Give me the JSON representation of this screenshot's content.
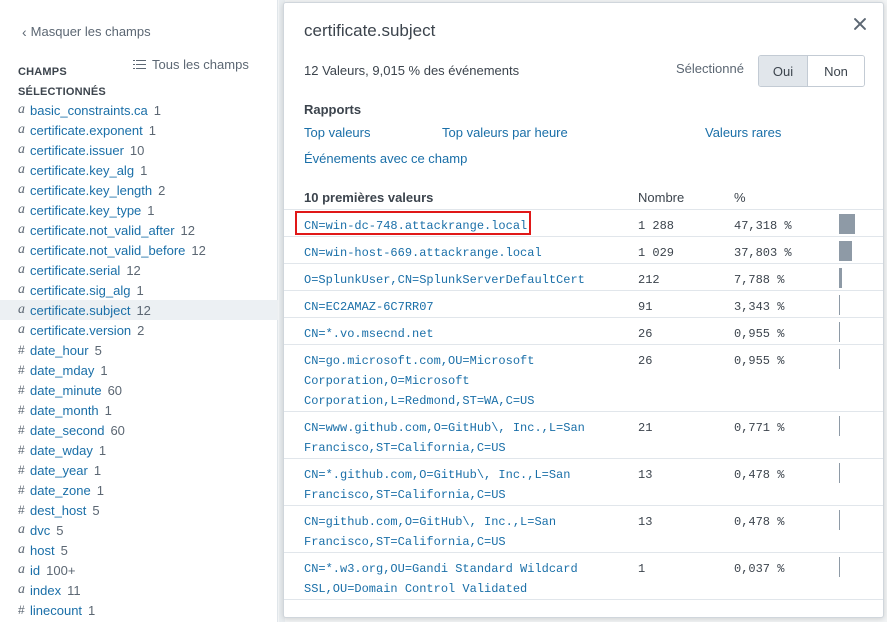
{
  "sidebar": {
    "hide_label": "Masquer les champs",
    "selected_line1": "CHAMPS",
    "selected_line2": "SÉLECTIONNÉS",
    "all_fields_label": "Tous les champs",
    "fields": [
      {
        "type": "a",
        "name": "basic_constraints.ca",
        "count": "1"
      },
      {
        "type": "a",
        "name": "certificate.exponent",
        "count": "1"
      },
      {
        "type": "a",
        "name": "certificate.issuer",
        "count": "10"
      },
      {
        "type": "a",
        "name": "certificate.key_alg",
        "count": "1"
      },
      {
        "type": "a",
        "name": "certificate.key_length",
        "count": "2"
      },
      {
        "type": "a",
        "name": "certificate.key_type",
        "count": "1"
      },
      {
        "type": "a",
        "name": "certificate.not_valid_after",
        "count": "12"
      },
      {
        "type": "a",
        "name": "certificate.not_valid_before",
        "count": "12"
      },
      {
        "type": "a",
        "name": "certificate.serial",
        "count": "12"
      },
      {
        "type": "a",
        "name": "certificate.sig_alg",
        "count": "1"
      },
      {
        "type": "a",
        "name": "certificate.subject",
        "count": "12",
        "active": true
      },
      {
        "type": "a",
        "name": "certificate.version",
        "count": "2"
      },
      {
        "type": "#",
        "name": "date_hour",
        "count": "5"
      },
      {
        "type": "#",
        "name": "date_mday",
        "count": "1"
      },
      {
        "type": "#",
        "name": "date_minute",
        "count": "60"
      },
      {
        "type": "#",
        "name": "date_month",
        "count": "1"
      },
      {
        "type": "#",
        "name": "date_second",
        "count": "60"
      },
      {
        "type": "#",
        "name": "date_wday",
        "count": "1"
      },
      {
        "type": "#",
        "name": "date_year",
        "count": "1"
      },
      {
        "type": "#",
        "name": "date_zone",
        "count": "1"
      },
      {
        "type": "#",
        "name": "dest_host",
        "count": "5"
      },
      {
        "type": "a",
        "name": "dvc",
        "count": "5"
      },
      {
        "type": "a",
        "name": "host",
        "count": "5"
      },
      {
        "type": "a",
        "name": "id",
        "count": "100+"
      },
      {
        "type": "a",
        "name": "index",
        "count": "11"
      },
      {
        "type": "#",
        "name": "linecount",
        "count": "1"
      }
    ]
  },
  "popup": {
    "title": "certificate.subject",
    "summary": "12 Valeurs, 9,015 % des événements",
    "selected_label": "Sélectionné",
    "yes_label": "Oui",
    "no_label": "Non",
    "reports_title": "Rapports",
    "reports": {
      "top_values": "Top valeurs",
      "top_values_hour": "Top valeurs par heure",
      "rare_values": "Valeurs rares",
      "events_with_field": "Événements avec ce champ"
    },
    "table": {
      "col_values": "10 premières valeurs",
      "col_count": "Nombre",
      "col_pct": "%",
      "rows": [
        {
          "value": "CN=win-dc-748.attackrange.local",
          "count": "1 288",
          "pct": "47,318 %",
          "share": 0.47318
        },
        {
          "value": "CN=win-host-669.attackrange.local",
          "count": "1 029",
          "pct": "37,803 %",
          "share": 0.37803
        },
        {
          "value": "O=SplunkUser,CN=SplunkServerDefaultCert",
          "count": "212",
          "pct": "7,788 %",
          "share": 0.07788
        },
        {
          "value": "CN=EC2AMAZ-6C7RR07",
          "count": "91",
          "pct": "3,343 %",
          "share": 0.03343
        },
        {
          "value": "CN=*.vo.msecnd.net",
          "count": "26",
          "pct": "0,955 %",
          "share": 0.00955
        },
        {
          "value": "CN=go.microsoft.com,OU=Microsoft Corporation,O=Microsoft Corporation,L=Redmond,ST=WA,C=US",
          "count": "26",
          "pct": "0,955 %",
          "share": 0.00955
        },
        {
          "value": "CN=www.github.com,O=GitHub\\, Inc.,L=San Francisco,ST=California,C=US",
          "count": "21",
          "pct": "0,771 %",
          "share": 0.00771
        },
        {
          "value": "CN=*.github.com,O=GitHub\\, Inc.,L=San Francisco,ST=California,C=US",
          "count": "13",
          "pct": "0,478 %",
          "share": 0.00478
        },
        {
          "value": "CN=github.com,O=GitHub\\, Inc.,L=San Francisco,ST=California,C=US",
          "count": "13",
          "pct": "0,478 %",
          "share": 0.00478
        },
        {
          "value": "CN=*.w3.org,OU=Gandi Standard Wildcard SSL,OU=Domain Control Validated",
          "count": "1",
          "pct": "0,037 %",
          "share": 0.00037
        }
      ]
    }
  }
}
